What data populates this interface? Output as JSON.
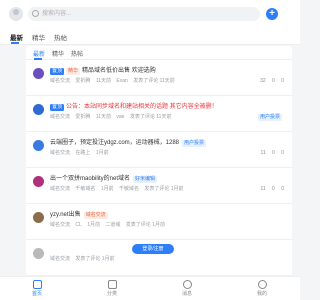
{
  "header": {
    "search_placeholder": "搜索内容..."
  },
  "tabs": [
    "最新",
    "精华",
    "热帖"
  ],
  "subtabs": [
    "最新",
    "精华",
    "热帖"
  ],
  "posts": [
    {
      "tags": [
        "置顶",
        "精华"
      ],
      "title": "精品域名低价出售 欢迎选购",
      "title_color": "normal",
      "forum": "域名交流",
      "author": "爱折腾",
      "time": "11天前",
      "reply_user": "Exan",
      "reply_time": "发表了评论 11天前",
      "stats": [
        "32",
        "0",
        "0"
      ]
    },
    {
      "tags": [
        "置顶"
      ],
      "title": "公告：本站同步域名和建站相关的话题 其它内容全被删！",
      "title_color": "red",
      "forum": "域名交流",
      "author": "爱折腾",
      "time": "11天前",
      "reply_user": "vae",
      "reply_time": "发表了评论 11天前",
      "stats": [
        "25",
        "0",
        "0"
      ],
      "trail_tag": "用户投票"
    },
    {
      "tags": [],
      "title": "云端圈子，预定投注ydgz.com，运动器械，1288",
      "title_color": "normal",
      "forum": "域名交流",
      "author": "在路上",
      "time": "1月前",
      "reply_user": "",
      "reply_time": "",
      "stats": [
        "11",
        "0",
        "0"
      ],
      "trail_tag": "用户投票"
    },
    {
      "tags": [],
      "title": "出一个双拼maobility的net域名",
      "title_color": "normal",
      "forum": "域名交流",
      "author": "千敏域名",
      "time": "1月前",
      "reply_user": "千敏域名",
      "reply_time": "发表了评论 1月前",
      "stats": [
        "11",
        "0",
        "0"
      ],
      "trail_tag": "",
      "extra_tags": [
        "好米编辑",
        "米币域名",
        "用户投票"
      ]
    },
    {
      "tags": [],
      "title": "yzy.net出售",
      "title_color": "normal",
      "forum": "域名交流",
      "author": "CL",
      "time": "1月前",
      "reply_user": "二道域",
      "reply_time": "发表了评论 1月前",
      "stats": [
        "",
        "",
        ""
      ],
      "trail_tag": "",
      "inline_tag": "域名交流"
    },
    {
      "tags": [],
      "title": "",
      "title_color": "normal",
      "forum": "域名交流",
      "author": "",
      "time": "",
      "reply_user": "",
      "reply_time": "发表了评论 1月前",
      "stats": [
        "",
        "",
        ""
      ]
    }
  ],
  "float_button": "登录/注册",
  "bottom_nav": [
    {
      "label": "首页",
      "icon": "home-icon",
      "active": true
    },
    {
      "label": "分类",
      "icon": "category-icon",
      "active": false
    },
    {
      "label": "消息",
      "icon": "message-icon",
      "active": false
    },
    {
      "label": "我的",
      "icon": "user-icon",
      "active": false
    }
  ],
  "colors": {
    "accent": "#2d7ff9",
    "hot": "#f0683e",
    "red_title": "#e9343c"
  }
}
